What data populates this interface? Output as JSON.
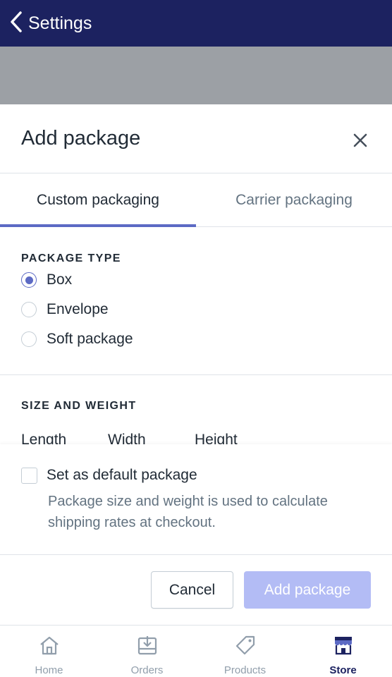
{
  "topbar": {
    "back_label": "Settings"
  },
  "sheet": {
    "title": "Add package",
    "tabs": [
      {
        "label": "Custom packaging",
        "active": true
      },
      {
        "label": "Carrier packaging",
        "active": false
      }
    ],
    "package_type": {
      "heading": "PACKAGE TYPE",
      "options": [
        {
          "label": "Box",
          "selected": true
        },
        {
          "label": "Envelope",
          "selected": false
        },
        {
          "label": "Soft package",
          "selected": false
        }
      ]
    },
    "size_weight": {
      "heading": "SIZE AND WEIGHT",
      "columns": [
        "Length",
        "Width",
        "Height"
      ]
    },
    "default_package": {
      "label": "Set as default package",
      "checked": false,
      "help": "Package size and weight is used to calculate shipping rates at checkout."
    },
    "buttons": {
      "cancel": "Cancel",
      "add": "Add package"
    }
  },
  "tabbar": {
    "items": [
      {
        "label": "Home",
        "icon": "home-icon",
        "active": false
      },
      {
        "label": "Orders",
        "icon": "orders-icon",
        "active": false
      },
      {
        "label": "Products",
        "icon": "tag-icon",
        "active": false
      },
      {
        "label": "Store",
        "icon": "store-icon",
        "active": true
      }
    ]
  },
  "colors": {
    "topbar": "#1c2260",
    "accent": "#5c6ac4",
    "disabled_primary": "#b3bcf5",
    "overlay": "#9ca0a5",
    "muted_text": "#637381"
  }
}
